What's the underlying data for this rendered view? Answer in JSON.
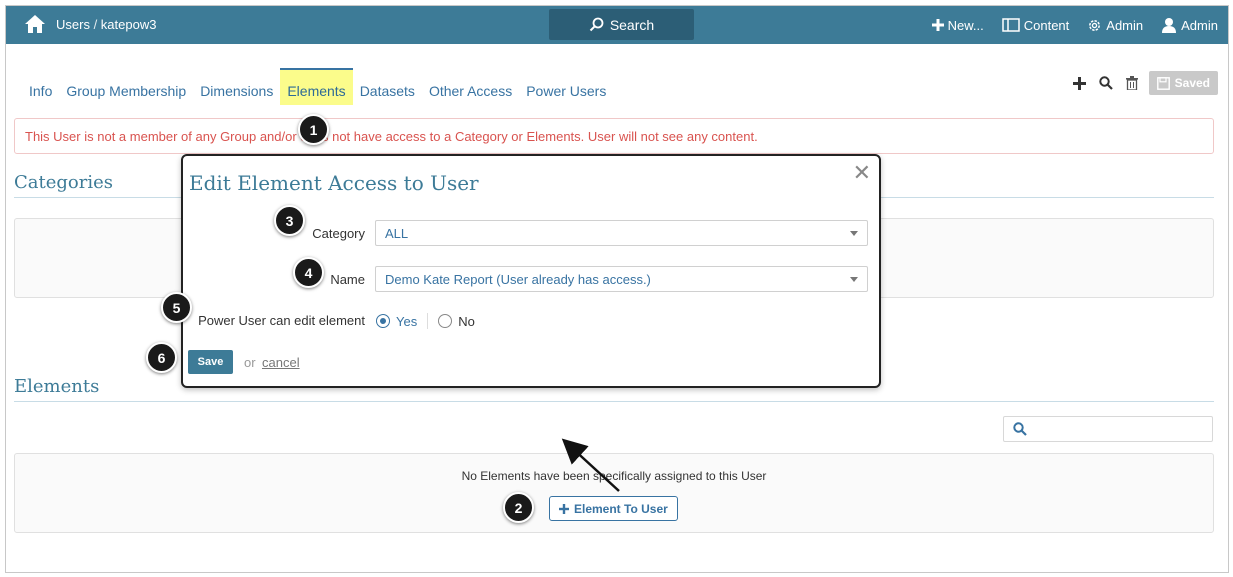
{
  "topbar": {
    "breadcrumb_root": "Users",
    "breadcrumb_sep": " / ",
    "breadcrumb_user": "katepow3",
    "search_label": "Search",
    "new_label": "New...",
    "content_label": "Content",
    "admin_label": "Admin",
    "user_label": "Admin"
  },
  "tabs": [
    {
      "label": "Info"
    },
    {
      "label": "Group Membership"
    },
    {
      "label": "Dimensions"
    },
    {
      "label": "Elements"
    },
    {
      "label": "Datasets"
    },
    {
      "label": "Other Access"
    },
    {
      "label": "Power Users"
    }
  ],
  "toolbar": {
    "saved_label": "Saved"
  },
  "alert": {
    "text": "This User is not a member of any Group and/or does not have access to a Category or Elements. User will not see any content."
  },
  "sections": {
    "categories_title": "Categories",
    "elements_title": "Elements"
  },
  "elements_panel": {
    "empty_text": "No Elements have been specifically assigned to this User",
    "add_button": "Element To User"
  },
  "modal": {
    "title": "Edit Element Access to User",
    "category_label": "Category",
    "category_value": "ALL",
    "name_label": "Name",
    "name_value": "Demo Kate Report (User already has access.)",
    "power_label": "Power User can edit element",
    "yes_label": "Yes",
    "no_label": "No",
    "power_selected": "Yes",
    "save_label": "Save",
    "or_text": "or",
    "cancel_label": "cancel"
  },
  "markers": [
    "1",
    "2",
    "3",
    "4",
    "5",
    "6"
  ],
  "colors": {
    "topbar": "#3d7b97",
    "search": "#2c5e76",
    "link": "#3873a2",
    "active_tab": "#fbfc8b",
    "alert_text": "#d9534f"
  }
}
